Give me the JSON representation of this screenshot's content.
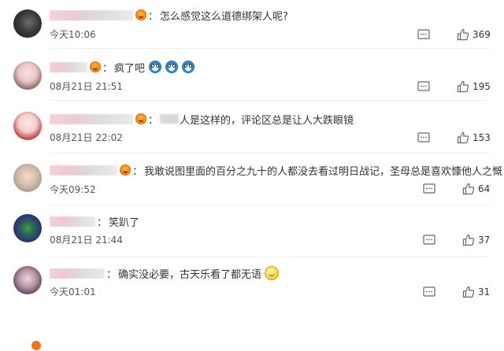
{
  "comments": [
    {
      "text": "怎么感觉这么道德绑架人呢?",
      "time": "今天10:06",
      "likes": "369"
    },
    {
      "text": "疯了吧",
      "time": "08月21日 21:51",
      "likes": "195"
    },
    {
      "text": "人是这样的，评论区总是让人大跌眼镜",
      "time": "08月21日 22:02",
      "likes": "153"
    },
    {
      "text": "我敢说图里面的百分之九十的人都没去看过明日战记，圣母总是喜欢慷他人之慨!",
      "time": "今天09:52",
      "likes": "64"
    },
    {
      "text": "笑趴了",
      "time": "08月21日 21:44",
      "likes": "37"
    },
    {
      "text": "确实没必要，古天乐看了都无语",
      "time": "今天01:01",
      "likes": "31"
    }
  ],
  "colon": "：",
  "icons": {
    "reply": "comment-reply-icon",
    "like": "thumbs-up-icon"
  }
}
